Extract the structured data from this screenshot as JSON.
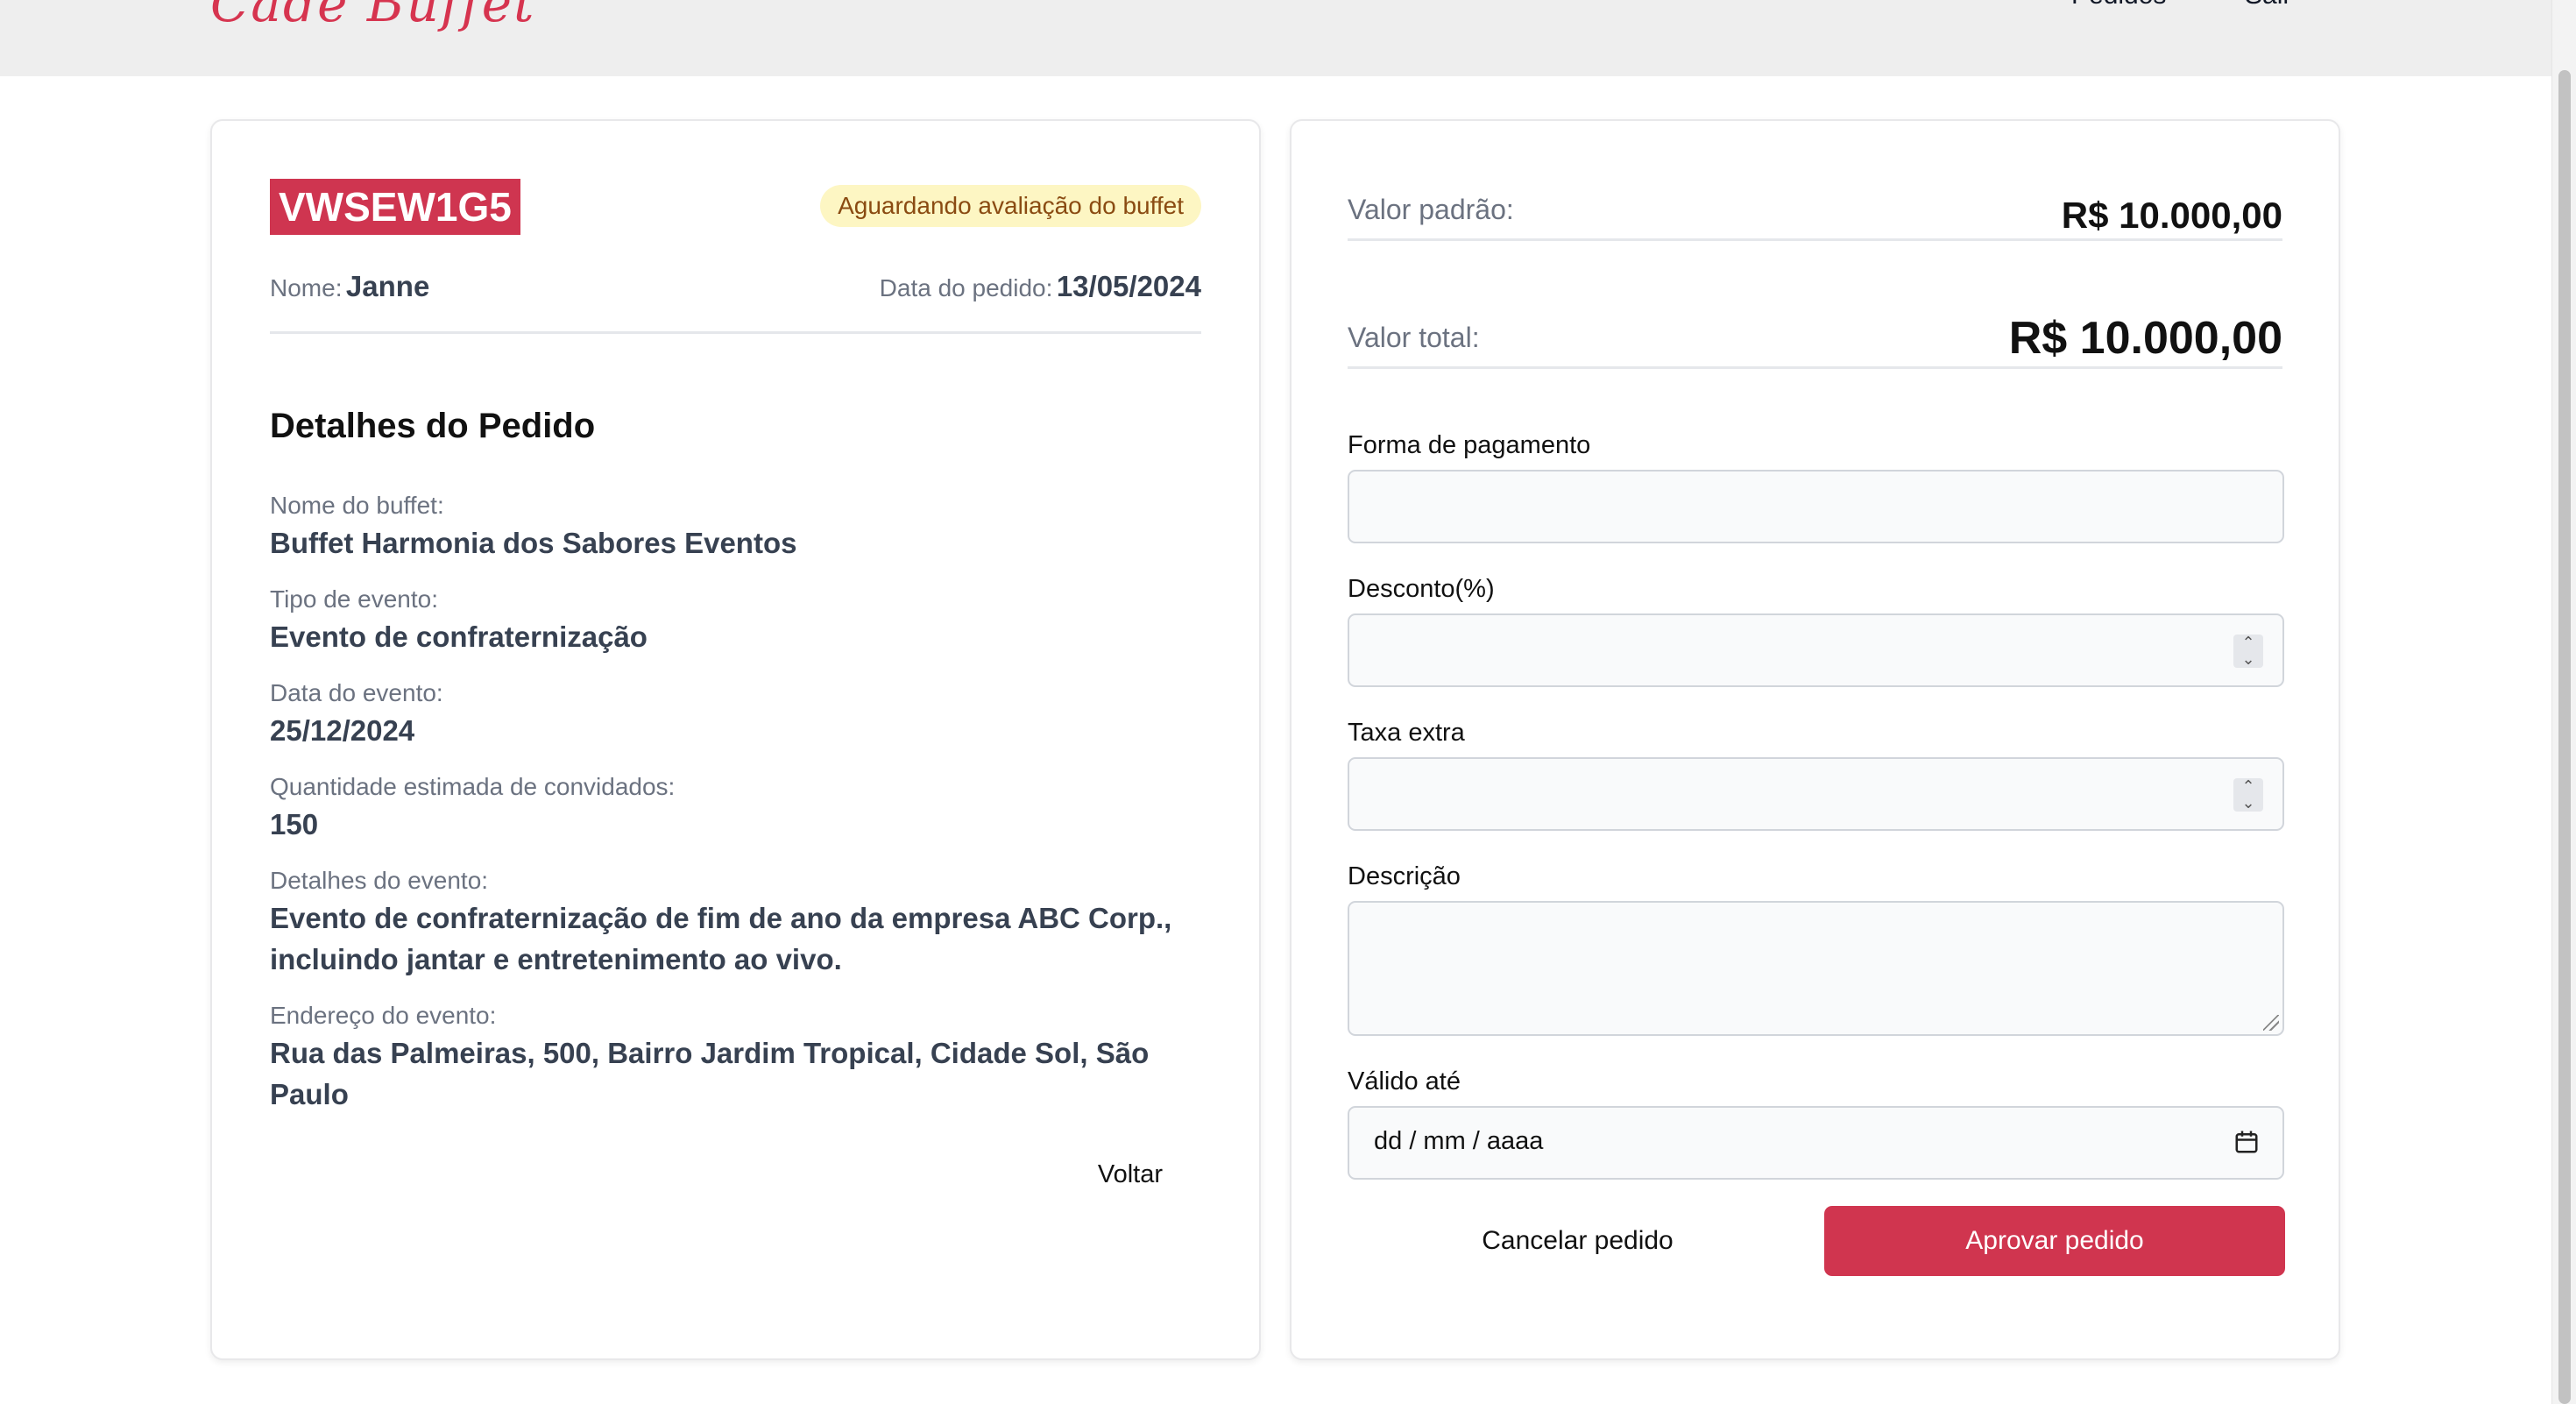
{
  "header": {
    "logo": "Cadê Buffet",
    "nav": [
      {
        "label": "Pedidos"
      },
      {
        "label": "Sair"
      }
    ]
  },
  "order": {
    "code": "VWSEW1G5",
    "status": "Aguardando avaliação do buffet",
    "name_label": "Nome:",
    "name": "Janne",
    "date_label": "Data do pedido:",
    "date": "13/05/2024"
  },
  "details": {
    "title": "Detalhes do Pedido",
    "items": [
      {
        "label": "Nome do buffet:",
        "value": "Buffet Harmonia dos Sabores Eventos"
      },
      {
        "label": "Tipo de evento:",
        "value": "Evento de confraternização"
      },
      {
        "label": "Data do evento:",
        "value": "25/12/2024"
      },
      {
        "label": "Quantidade estimada de convidados:",
        "value": "150"
      },
      {
        "label": "Detalhes do evento:",
        "value": "Evento de confraternização de fim de ano da empresa ABC Corp., incluindo jantar e entretenimento ao vivo."
      },
      {
        "label": "Endereço do evento:",
        "value": "Rua das Palmeiras, 500, Bairro Jardim Tropical, Cidade Sol, São Paulo"
      }
    ],
    "back_label": "Voltar"
  },
  "pricing": {
    "standard_label": "Valor padrão:",
    "standard_value": "R$ 10.000,00",
    "total_label": "Valor total:",
    "total_value": "R$ 10.000,00"
  },
  "form": {
    "payment_label": "Forma de pagamento",
    "payment_value": "",
    "discount_label": "Desconto(%)",
    "discount_value": "",
    "extra_fee_label": "Taxa extra",
    "extra_fee_value": "",
    "description_label": "Descrição",
    "description_value": "",
    "valid_until_label": "Válido até",
    "valid_until_placeholder": "dd / mm / aaaa",
    "cancel_label": "Cancelar pedido",
    "approve_label": "Aprovar pedido"
  },
  "colors": {
    "brand": "#d0354f",
    "status_bg": "#fdf6c3",
    "status_text": "#8a4b12"
  }
}
